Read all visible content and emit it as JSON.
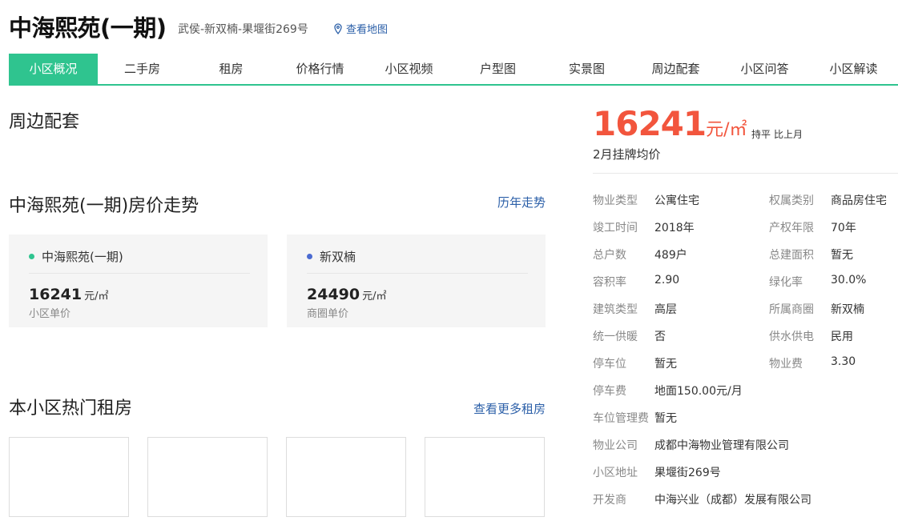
{
  "header": {
    "title": "中海熙苑(一期)",
    "address": "武侯-新双楠-果堰街269号",
    "map_link": "查看地图"
  },
  "tabs": [
    {
      "label": "小区概况",
      "active": true
    },
    {
      "label": "二手房"
    },
    {
      "label": "租房"
    },
    {
      "label": "价格行情"
    },
    {
      "label": "小区视频"
    },
    {
      "label": "户型图"
    },
    {
      "label": "实景图"
    },
    {
      "label": "周边配套"
    },
    {
      "label": "小区问答"
    },
    {
      "label": "小区解读"
    }
  ],
  "sections": {
    "surroundings": "周边配套",
    "price_trend": "中海熙苑(一期)房价走势",
    "history_link": "历年走势",
    "rentals": "本小区热门租房",
    "more_rentals_link": "查看更多租房"
  },
  "price_cards": [
    {
      "name": "中海熙苑(一期)",
      "value": "16241",
      "unit": "元/㎡",
      "sub": "小区单价",
      "dot_color": "#2fc48f"
    },
    {
      "name": "新双楠",
      "value": "24490",
      "unit": "元/㎡",
      "sub": "商圈单价",
      "dot_color": "#4b6bd1"
    }
  ],
  "summary": {
    "price": "16241",
    "unit": "元/㎡",
    "trend": "持平",
    "trend_label": "比上月",
    "month_label": "2月挂牌均价"
  },
  "info": {
    "property_type_k": "物业类型",
    "property_type_v": "公寓住宅",
    "ownership_k": "权属类别",
    "ownership_v": "商品房住宅",
    "completed_k": "竣工时间",
    "completed_v": "2018年",
    "term_k": "产权年限",
    "term_v": "70年",
    "households_k": "总户数",
    "households_v": "489户",
    "area_k": "总建面积",
    "area_v": "暂无",
    "far_k": "容积率",
    "far_v": "2.90",
    "green_k": "绿化率",
    "green_v": "30.0%",
    "building_k": "建筑类型",
    "building_v": "高层",
    "district_k": "所属商圈",
    "district_v": "新双楠",
    "heating_k": "统一供暖",
    "heating_v": "否",
    "utility_k": "供水供电",
    "utility_v": "民用",
    "parking_k": "停车位",
    "parking_v": "暂无",
    "fee_k": "物业费",
    "fee_v": "3.30",
    "parking_fee_k": "停车费",
    "parking_fee_v": "地面150.00元/月",
    "parking_mgmt_k": "车位管理费",
    "parking_mgmt_v": "暂无",
    "company_k": "物业公司",
    "company_v": "成都中海物业管理有限公司",
    "address_k": "小区地址",
    "address_v": "果堰街269号",
    "developer_k": "开发商",
    "developer_v": "中海兴业（成都）发展有限公司"
  }
}
